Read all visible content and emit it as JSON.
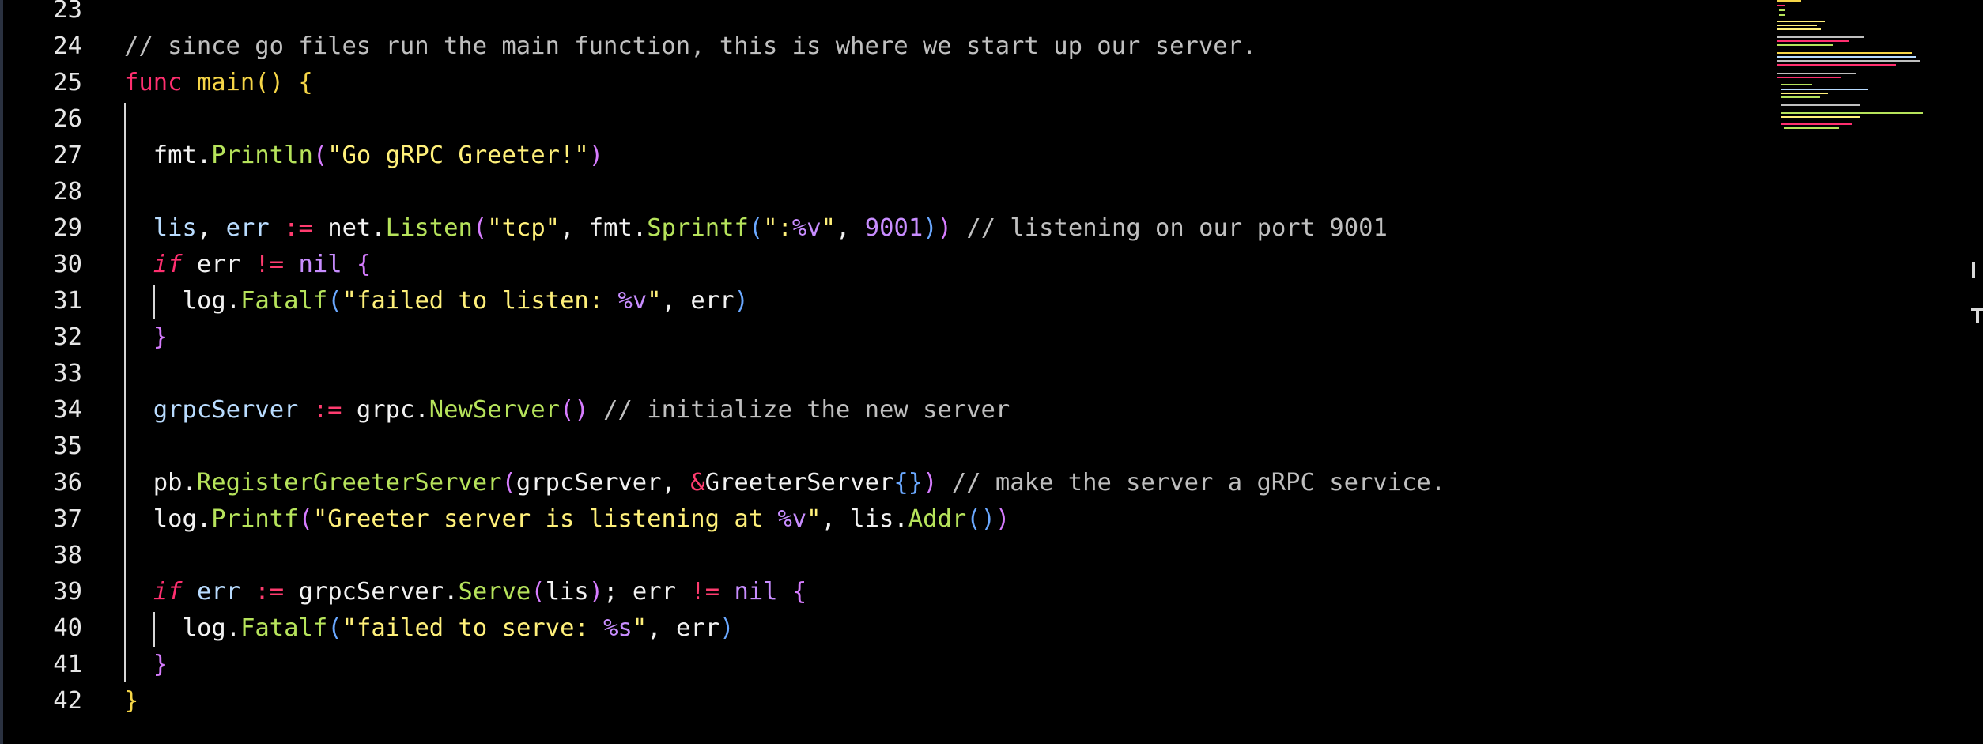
{
  "editor": {
    "language": "go",
    "colors": {
      "background": "#000000",
      "keyword": "#ff2f6f",
      "function": "#f5d547",
      "method": "#b6e35b",
      "string": "#fff07a",
      "comment": "#bfbfbf",
      "number": "#c88dff",
      "identifier": "#b9dcff"
    },
    "lines": [
      {
        "number": "23",
        "tokens": []
      },
      {
        "number": "24",
        "tokens": [
          {
            "t": "// since go files run the main function, this is where we start up our server.",
            "c": "cm"
          }
        ]
      },
      {
        "number": "25",
        "tokens": [
          {
            "t": "func",
            "c": "kw"
          },
          {
            "t": " ",
            "c": "pu"
          },
          {
            "t": "main",
            "c": "fn"
          },
          {
            "t": "()",
            "c": "p1"
          },
          {
            "t": " ",
            "c": "pu"
          },
          {
            "t": "{",
            "c": "p1"
          }
        ]
      },
      {
        "number": "26",
        "tokens": []
      },
      {
        "number": "27",
        "tokens": [
          {
            "t": "fmt",
            "c": "pk"
          },
          {
            "t": ".",
            "c": "pu"
          },
          {
            "t": "Println",
            "c": "me"
          },
          {
            "t": "(",
            "c": "p2"
          },
          {
            "t": "\"Go gRPC Greeter!\"",
            "c": "st"
          },
          {
            "t": ")",
            "c": "p2"
          }
        ]
      },
      {
        "number": "28",
        "tokens": []
      },
      {
        "number": "29",
        "tokens": [
          {
            "t": "lis",
            "c": "id"
          },
          {
            "t": ", ",
            "c": "pu"
          },
          {
            "t": "err",
            "c": "id"
          },
          {
            "t": " ",
            "c": "pu"
          },
          {
            "t": ":=",
            "c": "op"
          },
          {
            "t": " ",
            "c": "pu"
          },
          {
            "t": "net",
            "c": "pk"
          },
          {
            "t": ".",
            "c": "pu"
          },
          {
            "t": "Listen",
            "c": "me"
          },
          {
            "t": "(",
            "c": "p2"
          },
          {
            "t": "\"tcp\"",
            "c": "st"
          },
          {
            "t": ", ",
            "c": "pu"
          },
          {
            "t": "fmt",
            "c": "pk"
          },
          {
            "t": ".",
            "c": "pu"
          },
          {
            "t": "Sprintf",
            "c": "me"
          },
          {
            "t": "(",
            "c": "p3"
          },
          {
            "t": "\":",
            "c": "st"
          },
          {
            "t": "%v",
            "c": "fm"
          },
          {
            "t": "\"",
            "c": "st"
          },
          {
            "t": ", ",
            "c": "pu"
          },
          {
            "t": "9001",
            "c": "nu"
          },
          {
            "t": ")",
            "c": "p3"
          },
          {
            "t": ")",
            "c": "p2"
          },
          {
            "t": " // listening on our port 9001",
            "c": "cm"
          }
        ]
      },
      {
        "number": "30",
        "tokens": [
          {
            "t": "if",
            "c": "kwi"
          },
          {
            "t": " err ",
            "c": "pk"
          },
          {
            "t": "!=",
            "c": "op"
          },
          {
            "t": " ",
            "c": "pu"
          },
          {
            "t": "nil",
            "c": "ni"
          },
          {
            "t": " ",
            "c": "pu"
          },
          {
            "t": "{",
            "c": "p2"
          }
        ]
      },
      {
        "number": "31",
        "tokens": [
          {
            "t": "log",
            "c": "pk"
          },
          {
            "t": ".",
            "c": "pu"
          },
          {
            "t": "Fatalf",
            "c": "me"
          },
          {
            "t": "(",
            "c": "p3"
          },
          {
            "t": "\"failed to listen: ",
            "c": "st"
          },
          {
            "t": "%v",
            "c": "fm"
          },
          {
            "t": "\"",
            "c": "st"
          },
          {
            "t": ", err",
            "c": "pk"
          },
          {
            "t": ")",
            "c": "p3"
          }
        ]
      },
      {
        "number": "32",
        "tokens": [
          {
            "t": "}",
            "c": "p2"
          }
        ]
      },
      {
        "number": "33",
        "tokens": []
      },
      {
        "number": "34",
        "tokens": [
          {
            "t": "grpcServer",
            "c": "id"
          },
          {
            "t": " ",
            "c": "pu"
          },
          {
            "t": ":=",
            "c": "op"
          },
          {
            "t": " grpc",
            "c": "pk"
          },
          {
            "t": ".",
            "c": "pu"
          },
          {
            "t": "NewServer",
            "c": "me"
          },
          {
            "t": "()",
            "c": "p2"
          },
          {
            "t": " // initialize the new server",
            "c": "cm"
          }
        ]
      },
      {
        "number": "35",
        "tokens": []
      },
      {
        "number": "36",
        "tokens": [
          {
            "t": "pb",
            "c": "pk"
          },
          {
            "t": ".",
            "c": "pu"
          },
          {
            "t": "RegisterGreeterServer",
            "c": "me"
          },
          {
            "t": "(",
            "c": "p2"
          },
          {
            "t": "grpcServer, ",
            "c": "pk"
          },
          {
            "t": "&",
            "c": "op"
          },
          {
            "t": "GreeterServer",
            "c": "pk"
          },
          {
            "t": "{}",
            "c": "p3"
          },
          {
            "t": ")",
            "c": "p2"
          },
          {
            "t": " // make the server a gRPC service.",
            "c": "cm"
          }
        ]
      },
      {
        "number": "37",
        "tokens": [
          {
            "t": "log",
            "c": "pk"
          },
          {
            "t": ".",
            "c": "pu"
          },
          {
            "t": "Printf",
            "c": "me"
          },
          {
            "t": "(",
            "c": "p2"
          },
          {
            "t": "\"Greeter server is listening at ",
            "c": "st"
          },
          {
            "t": "%v",
            "c": "fm"
          },
          {
            "t": "\"",
            "c": "st"
          },
          {
            "t": ", lis",
            "c": "pk"
          },
          {
            "t": ".",
            "c": "pu"
          },
          {
            "t": "Addr",
            "c": "me"
          },
          {
            "t": "()",
            "c": "p3"
          },
          {
            "t": ")",
            "c": "p2"
          }
        ]
      },
      {
        "number": "38",
        "tokens": []
      },
      {
        "number": "39",
        "tokens": [
          {
            "t": "if",
            "c": "kwi"
          },
          {
            "t": " ",
            "c": "pu"
          },
          {
            "t": "err",
            "c": "id"
          },
          {
            "t": " ",
            "c": "pu"
          },
          {
            "t": ":=",
            "c": "op"
          },
          {
            "t": " grpcServer",
            "c": "pk"
          },
          {
            "t": ".",
            "c": "pu"
          },
          {
            "t": "Serve",
            "c": "me"
          },
          {
            "t": "(",
            "c": "p2"
          },
          {
            "t": "lis",
            "c": "pk"
          },
          {
            "t": ")",
            "c": "p2"
          },
          {
            "t": "; err ",
            "c": "pk"
          },
          {
            "t": "!=",
            "c": "op"
          },
          {
            "t": " ",
            "c": "pu"
          },
          {
            "t": "nil",
            "c": "ni"
          },
          {
            "t": " ",
            "c": "pu"
          },
          {
            "t": "{",
            "c": "p2"
          }
        ]
      },
      {
        "number": "40",
        "tokens": [
          {
            "t": "log",
            "c": "pk"
          },
          {
            "t": ".",
            "c": "pu"
          },
          {
            "t": "Fatalf",
            "c": "me"
          },
          {
            "t": "(",
            "c": "p3"
          },
          {
            "t": "\"failed to serve: ",
            "c": "st"
          },
          {
            "t": "%s",
            "c": "fm"
          },
          {
            "t": "\"",
            "c": "st"
          },
          {
            "t": ", err",
            "c": "pk"
          },
          {
            "t": ")",
            "c": "p3"
          }
        ]
      },
      {
        "number": "41",
        "tokens": [
          {
            "t": "}",
            "c": "p2"
          }
        ]
      },
      {
        "number": "42",
        "tokens": [
          {
            "t": "}",
            "c": "p1"
          }
        ]
      }
    ]
  }
}
